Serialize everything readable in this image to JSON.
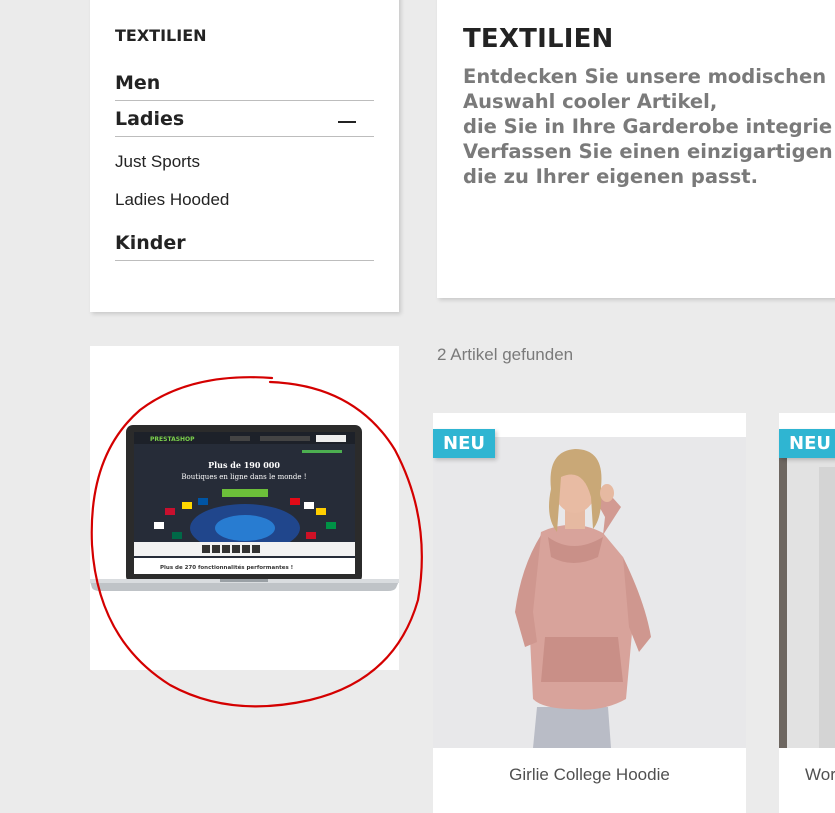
{
  "sidebar": {
    "title": "TEXTILIEN",
    "items": [
      {
        "label": "Men"
      },
      {
        "label": "Ladies"
      },
      {
        "label": "Kinder"
      }
    ],
    "sub_items": [
      {
        "label": "Just Sports"
      },
      {
        "label": "Ladies Hooded"
      }
    ],
    "collapse_icon": "minus-icon"
  },
  "header": {
    "title": "TEXTILIEN",
    "description_lines": [
      "Entdecken Sie unsere modischen",
      "Auswahl cooler Artikel,",
      "die Sie in Ihre Garderobe integrie",
      "Verfassen Sie einen einzigartigen",
      "die zu Ihrer eigenen passt."
    ]
  },
  "ad": {
    "screen_brand": "PRESTASHOP",
    "screen_headline_1": "Plus de 190 000",
    "screen_headline_2": "Boutiques en ligne dans le monde !",
    "screen_footer": "Plus de 270 fonctionnalités performantes !"
  },
  "listing": {
    "count_text": "2 Artikel gefunden"
  },
  "products": [
    {
      "badge": "NEU",
      "name": "Girlie College Hoodie"
    },
    {
      "badge": "NEU",
      "name": "Wor"
    }
  ],
  "colors": {
    "badge": "#2fb5d2",
    "background": "#ebebeb",
    "annotation": "#d40000"
  }
}
